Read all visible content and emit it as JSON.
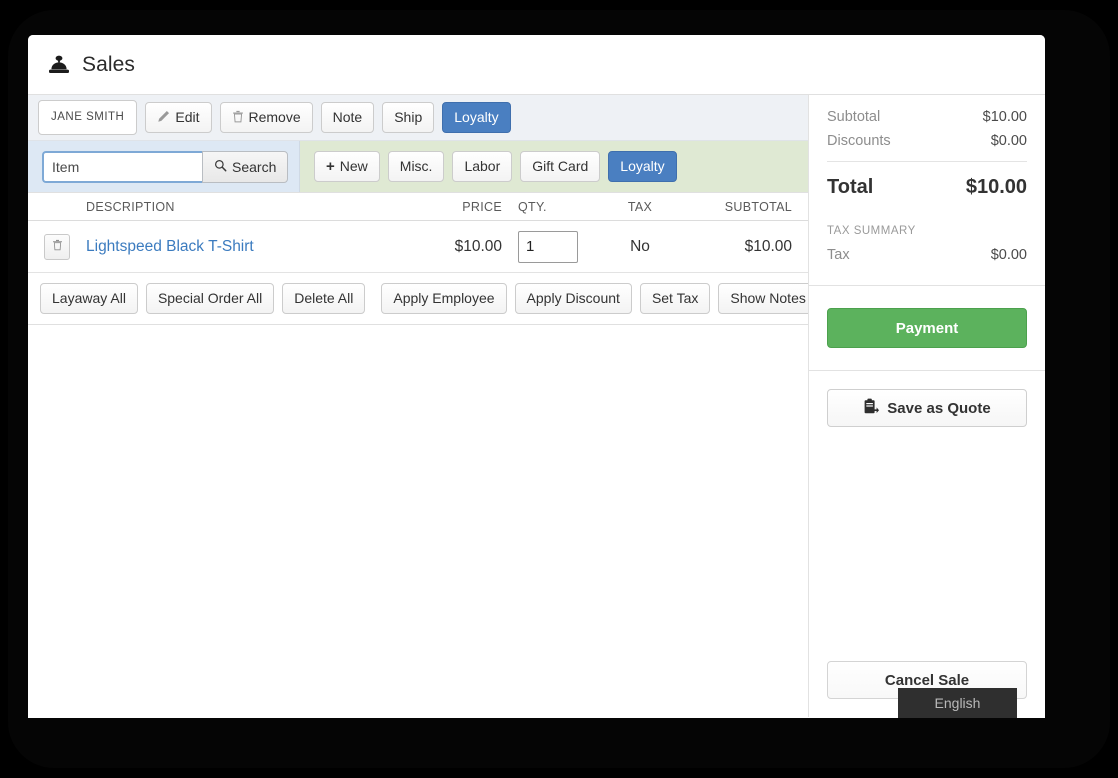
{
  "window": {
    "title": "Sales",
    "title_icon": "cash-register-icon"
  },
  "toolbar": {
    "customer_name": "JANE SMITH",
    "edit_label": "Edit",
    "edit_icon": "pencil-icon",
    "remove_label": "Remove",
    "remove_icon": "trash-icon",
    "note_label": "Note",
    "ship_label": "Ship",
    "loyalty_label": "Loyalty"
  },
  "search": {
    "placeholder": "Item",
    "value": "",
    "button_label": "Search",
    "button_icon": "search-icon"
  },
  "item_types": {
    "new_label": "New",
    "new_icon": "plus-icon",
    "misc_label": "Misc.",
    "labor_label": "Labor",
    "gift_card_label": "Gift Card",
    "loyalty_label": "Loyalty"
  },
  "table": {
    "headers": {
      "description": "DESCRIPTION",
      "price": "PRICE",
      "qty": "QTY.",
      "tax": "TAX",
      "subtotal": "SUBTOTAL"
    },
    "rows": [
      {
        "delete_icon": "trash-icon",
        "description": "Lightspeed Black T-Shirt",
        "price": "$10.00",
        "qty": "1",
        "tax": "No",
        "subtotal": "$10.00"
      }
    ]
  },
  "bulk_actions": {
    "layaway_all": "Layaway All",
    "special_order_all": "Special Order All",
    "delete_all": "Delete All",
    "apply_employee": "Apply Employee",
    "apply_discount": "Apply Discount",
    "set_tax": "Set Tax",
    "show_notes": "Show Notes"
  },
  "summary": {
    "subtotal_label": "Subtotal",
    "subtotal_value": "$10.00",
    "discounts_label": "Discounts",
    "discounts_value": "$0.00",
    "total_label": "Total",
    "total_value": "$10.00",
    "tax_summary_caption": "TAX SUMMARY",
    "tax_label": "Tax",
    "tax_value": "$0.00"
  },
  "actions": {
    "payment_label": "Payment",
    "save_quote_label": "Save as Quote",
    "save_quote_icon": "clipboard-quote-icon",
    "cancel_sale_label": "Cancel Sale"
  },
  "overlay": {
    "language_label": "English"
  },
  "colors": {
    "accent_blue": "#4a7fc1",
    "payment_green": "#5cb25d",
    "link_blue": "#3b7bbf",
    "search_zone": "#dde8f4",
    "item_zone": "#dfe9d3",
    "toolbar_bg": "#eef1f5",
    "badge_bg": "#2f2f2f"
  }
}
